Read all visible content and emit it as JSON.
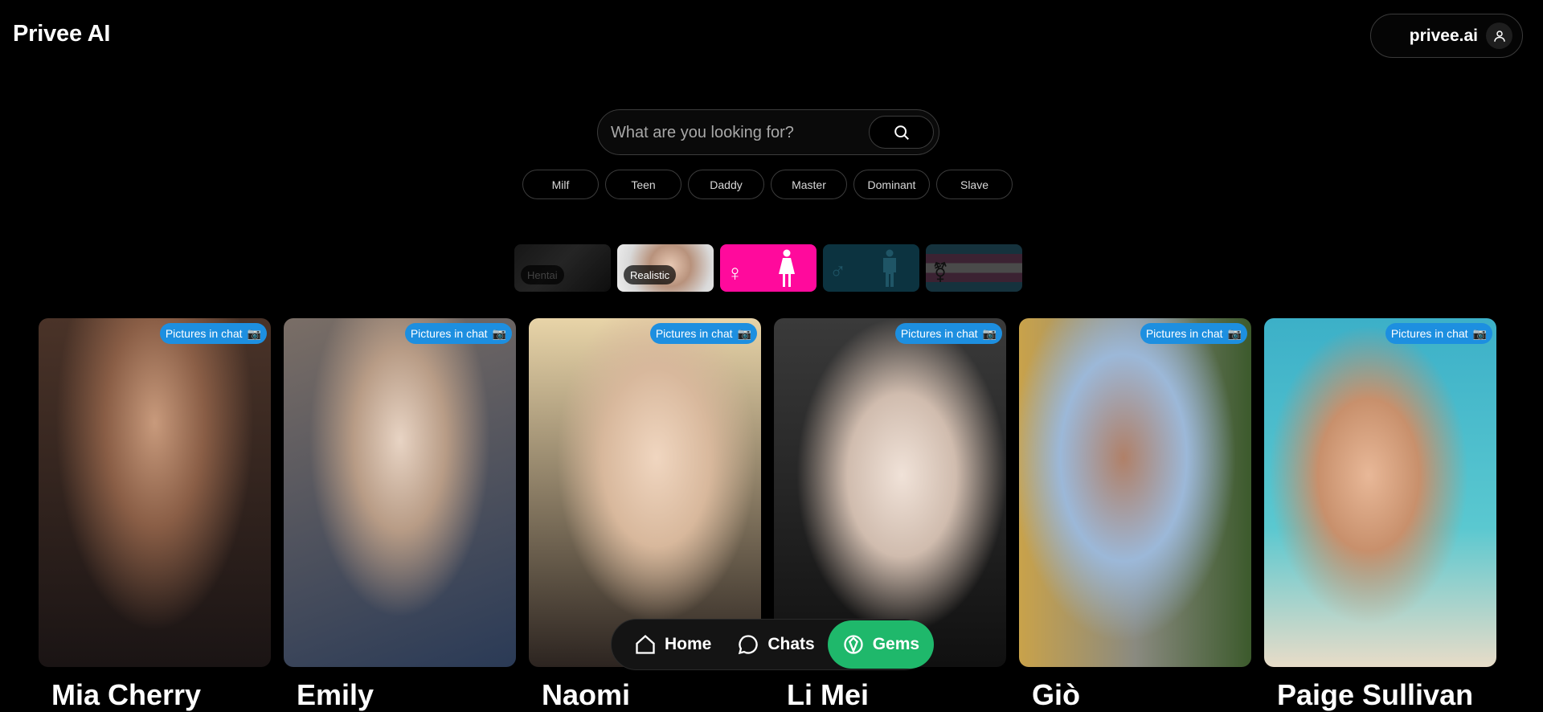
{
  "app": {
    "title": "Privee AI"
  },
  "account": {
    "label": "privee.ai"
  },
  "search": {
    "placeholder": "What are you looking for?"
  },
  "tags": [
    "Milf",
    "Teen",
    "Daddy",
    "Master",
    "Dominant",
    "Slave"
  ],
  "style_filters": [
    {
      "label": "Hentai",
      "selected": false
    },
    {
      "label": "Realistic",
      "selected": true
    },
    {
      "label": "Female",
      "icon": "female-icon",
      "selected": true,
      "color": "#ff0a9c"
    },
    {
      "label": "Male",
      "icon": "male-icon",
      "selected": false,
      "color": "#0c3340"
    },
    {
      "label": "Trans",
      "icon": "transgender-icon",
      "selected": false
    }
  ],
  "cards": [
    {
      "name": "Mia Cherry",
      "badge": "Pictures in chat",
      "bg": [
        "#4a3328",
        "#c89a7c",
        "#1a1414"
      ]
    },
    {
      "name": "Emily",
      "badge": "Pictures in chat",
      "bg": [
        "#6e6a66",
        "#e8e2dc",
        "#2a3a56"
      ]
    },
    {
      "name": "Naomi",
      "badge": "Pictures in chat",
      "bg": [
        "#e8d4a8",
        "#f0d6c0",
        "#2c2420"
      ]
    },
    {
      "name": "Li Mei",
      "badge": "Pictures in chat",
      "bg": [
        "#2a2a2a",
        "#f0e2d8",
        "#101010"
      ]
    },
    {
      "name": "Giò",
      "badge": "Pictures in chat",
      "bg": [
        "#c9a24a",
        "#9cb8d8",
        "#3c5a2c"
      ]
    },
    {
      "name": "Paige Sullivan",
      "badge": "Pictures in chat",
      "bg": [
        "#3cb0c8",
        "#e8b898",
        "#5ac8d0"
      ]
    }
  ],
  "bottom_nav": {
    "home": "Home",
    "chats": "Chats",
    "gems": "Gems"
  },
  "colors": {
    "accent_pink": "#ff0a9c",
    "badge_blue": "#1d8fe0",
    "gems_green": "#1fb86b"
  }
}
